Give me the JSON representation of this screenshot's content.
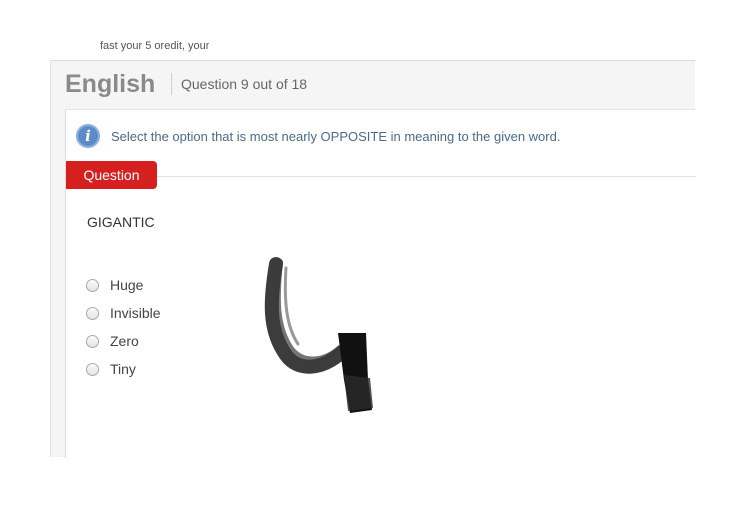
{
  "top_cut_text": "fast your 5 oredit, your",
  "header": {
    "subject": "English",
    "question_counter": "Question 9 out of 18"
  },
  "instruction": {
    "icon": "info-icon",
    "text": "Select the option that is most nearly OPPOSITE in meaning to the given word."
  },
  "question": {
    "tab_label": "Question",
    "word": "GIGANTIC",
    "options": [
      {
        "label": "Huge",
        "selected": false
      },
      {
        "label": "Invisible",
        "selected": false
      },
      {
        "label": "Zero",
        "selected": false
      },
      {
        "label": "Tiny",
        "selected": false
      }
    ]
  },
  "annotation": {
    "type": "handwritten numeral scribble",
    "color": "#1a1a1a"
  },
  "colors": {
    "accent_red": "#d62020",
    "info_blue": "#5b8bc8",
    "instruction_text": "#4a6a8a"
  }
}
